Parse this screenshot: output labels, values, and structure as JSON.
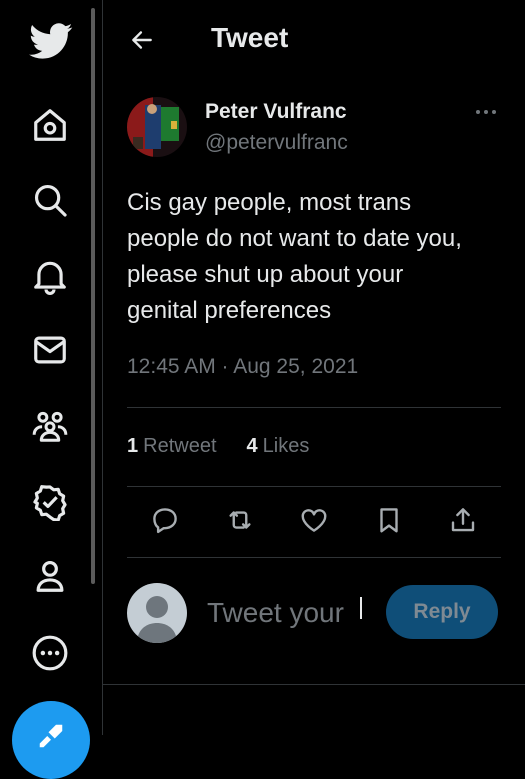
{
  "sidebar": {
    "items": [
      {
        "icon": "twitter-bird-icon"
      },
      {
        "icon": "home-icon"
      },
      {
        "icon": "search-icon"
      },
      {
        "icon": "bell-icon"
      },
      {
        "icon": "mail-icon"
      },
      {
        "icon": "communities-icon"
      },
      {
        "icon": "verified-icon"
      },
      {
        "icon": "profile-icon"
      },
      {
        "icon": "more-circle-icon"
      }
    ],
    "compose_icon": "compose-tweet-icon"
  },
  "header": {
    "title": "Tweet",
    "back_icon": "arrow-left-icon"
  },
  "tweet": {
    "author_name": "Peter Vulfranc",
    "author_handle": "@petervulfranc",
    "text_lines": [
      "Cis gay people, most trans",
      "people do not want to date you,",
      "please shut up about your",
      "genital preferences"
    ],
    "timestamp": "12:45 AM · Aug 25, 2021",
    "retweets_count": "1",
    "retweets_label": "Retweet",
    "likes_count": "4",
    "likes_label": "Likes"
  },
  "actions": [
    "reply-icon",
    "retweet-icon",
    "like-icon",
    "bookmark-icon",
    "share-icon"
  ],
  "reply": {
    "placeholder": "Tweet your",
    "button_label": "Reply"
  },
  "colors": {
    "background": "#000000",
    "text": "#e7e9ea",
    "muted": "#71767b",
    "accent": "#1d9bf0",
    "reply_button": "#0f4e78",
    "divider": "#2f3336"
  }
}
